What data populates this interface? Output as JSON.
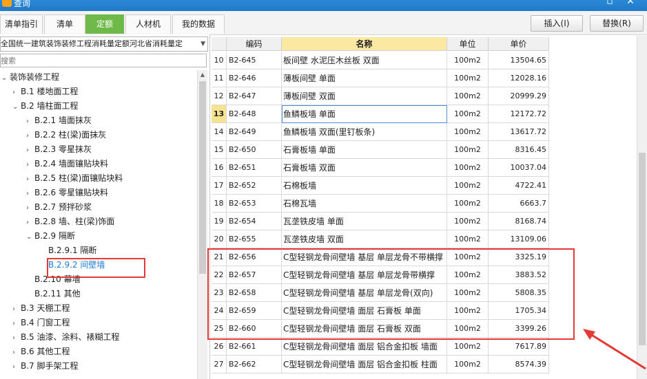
{
  "window": {
    "title": "查询",
    "accent_color": "#1f79c8"
  },
  "tabs": [
    {
      "label": "清单指引"
    },
    {
      "label": "清单"
    },
    {
      "label": "定额"
    },
    {
      "label": "人材机"
    },
    {
      "label": "我的数据"
    }
  ],
  "active_tab": "定额",
  "active_tab_color": "#6fb94a",
  "toolbar": {
    "insert_label": "插入(I)",
    "replace_label": "替换(R)"
  },
  "left_panel": {
    "library_value": "全国统一建筑装饰装修工程消耗量定额河北省消耗量定",
    "search_placeholder": "搜索",
    "tree": [
      {
        "label": "装饰装修工程",
        "expand": "expanded"
      },
      {
        "label": "B.1  楼地面工程",
        "expand": "collapsed"
      },
      {
        "label": "B.2  墙柱面工程",
        "expand": "expanded"
      },
      {
        "label": "B.2.1  墙面抹灰",
        "expand": "collapsed"
      },
      {
        "label": "B.2.2  柱(梁)面抹灰",
        "expand": "collapsed"
      },
      {
        "label": "B.2.3  零星抹灰",
        "expand": "collapsed"
      },
      {
        "label": "B.2.4  墙面镶贴块料",
        "expand": "collapsed"
      },
      {
        "label": "B.2.5  柱(梁)面镶贴块料",
        "expand": "collapsed"
      },
      {
        "label": "B.2.6  零星镶贴块料",
        "expand": "collapsed"
      },
      {
        "label": "B.2.7  预拌砂浆",
        "expand": "collapsed"
      },
      {
        "label": "B.2.8  墙、柱(梁)饰面",
        "expand": "collapsed"
      },
      {
        "label": "B.2.9  隔断",
        "expand": "expanded"
      },
      {
        "label": "B.2.9.1  隔断",
        "expand": "none"
      },
      {
        "label": "B.2.9.2  间壁墙",
        "expand": "none",
        "selected": true
      },
      {
        "label": "B.2.10  幕墙",
        "expand": "none"
      },
      {
        "label": "B.2.11  其他",
        "expand": "none"
      },
      {
        "label": "B.3  天棚工程",
        "expand": "collapsed"
      },
      {
        "label": "B.4  门窗工程",
        "expand": "collapsed"
      },
      {
        "label": "B.5  油漆、涂料、裱糊工程",
        "expand": "collapsed"
      },
      {
        "label": "B.6  其他工程",
        "expand": "collapsed"
      },
      {
        "label": "B.7  脚手架工程",
        "expand": "collapsed"
      }
    ]
  },
  "grid": {
    "columns": {
      "code": "编码",
      "name": "名称",
      "unit": "单位",
      "price": "单价"
    },
    "rows": [
      {
        "no": "10",
        "code": "B2-645",
        "name": "板间壁 水泥压木丝板 双面",
        "unit": "100m2",
        "price": "13504.65"
      },
      {
        "no": "11",
        "code": "B2-646",
        "name": "薄板间壁 单面",
        "unit": "100m2",
        "price": "12028.16"
      },
      {
        "no": "12",
        "code": "B2-647",
        "name": "薄板间壁 双面",
        "unit": "100m2",
        "price": "20999.29"
      },
      {
        "no": "13",
        "code": "B2-648",
        "name": "鱼鳞板墙 单面",
        "unit": "100m2",
        "price": "12172.72",
        "current": true
      },
      {
        "no": "14",
        "code": "B2-649",
        "name": "鱼鳞板墙 双面(里钉板条)",
        "unit": "100m2",
        "price": "13617.72"
      },
      {
        "no": "15",
        "code": "B2-650",
        "name": "石膏板墙 单面",
        "unit": "100m2",
        "price": "8316.45"
      },
      {
        "no": "16",
        "code": "B2-651",
        "name": "石膏板墙 双面",
        "unit": "100m2",
        "price": "10037.04"
      },
      {
        "no": "17",
        "code": "B2-652",
        "name": "石棉板墙",
        "unit": "100m2",
        "price": "4722.41"
      },
      {
        "no": "18",
        "code": "B2-653",
        "name": "石棉瓦墙",
        "unit": "100m2",
        "price": "6663.7"
      },
      {
        "no": "19",
        "code": "B2-654",
        "name": "瓦垄铁皮墙 单面",
        "unit": "100m2",
        "price": "8168.74"
      },
      {
        "no": "20",
        "code": "B2-655",
        "name": "瓦垄铁皮墙 双面",
        "unit": "100m2",
        "price": "13109.06"
      },
      {
        "no": "21",
        "code": "B2-656",
        "name": "C型轻钢龙骨间壁墙 基层 单层龙骨不带横撑",
        "unit": "100m2",
        "price": "3325.19"
      },
      {
        "no": "22",
        "code": "B2-657",
        "name": "C型轻钢龙骨间壁墙 基层 单层龙骨带横撑",
        "unit": "100m2",
        "price": "3883.52"
      },
      {
        "no": "23",
        "code": "B2-658",
        "name": "C型轻钢龙骨间壁墙 基层 单层龙骨(双向)",
        "unit": "100m2",
        "price": "5808.35"
      },
      {
        "no": "24",
        "code": "B2-659",
        "name": "C型轻钢龙骨间壁墙 面层 石膏板 单面",
        "unit": "100m2",
        "price": "1705.34"
      },
      {
        "no": "25",
        "code": "B2-660",
        "name": "C型轻钢龙骨间壁墙 面层 石膏板 双面",
        "unit": "100m2",
        "price": "3399.26"
      },
      {
        "no": "26",
        "code": "B2-661",
        "name": "C型轻钢龙骨间壁墙 面层 铝合金扣板 墙面",
        "unit": "100m2",
        "price": "7617.89"
      },
      {
        "no": "27",
        "code": "B2-662",
        "name": "C型轻钢龙骨间壁墙 面层 铝合金扣板 柱面",
        "unit": "100m2",
        "price": "8574.39"
      }
    ]
  },
  "annotation_color": "#e53935"
}
